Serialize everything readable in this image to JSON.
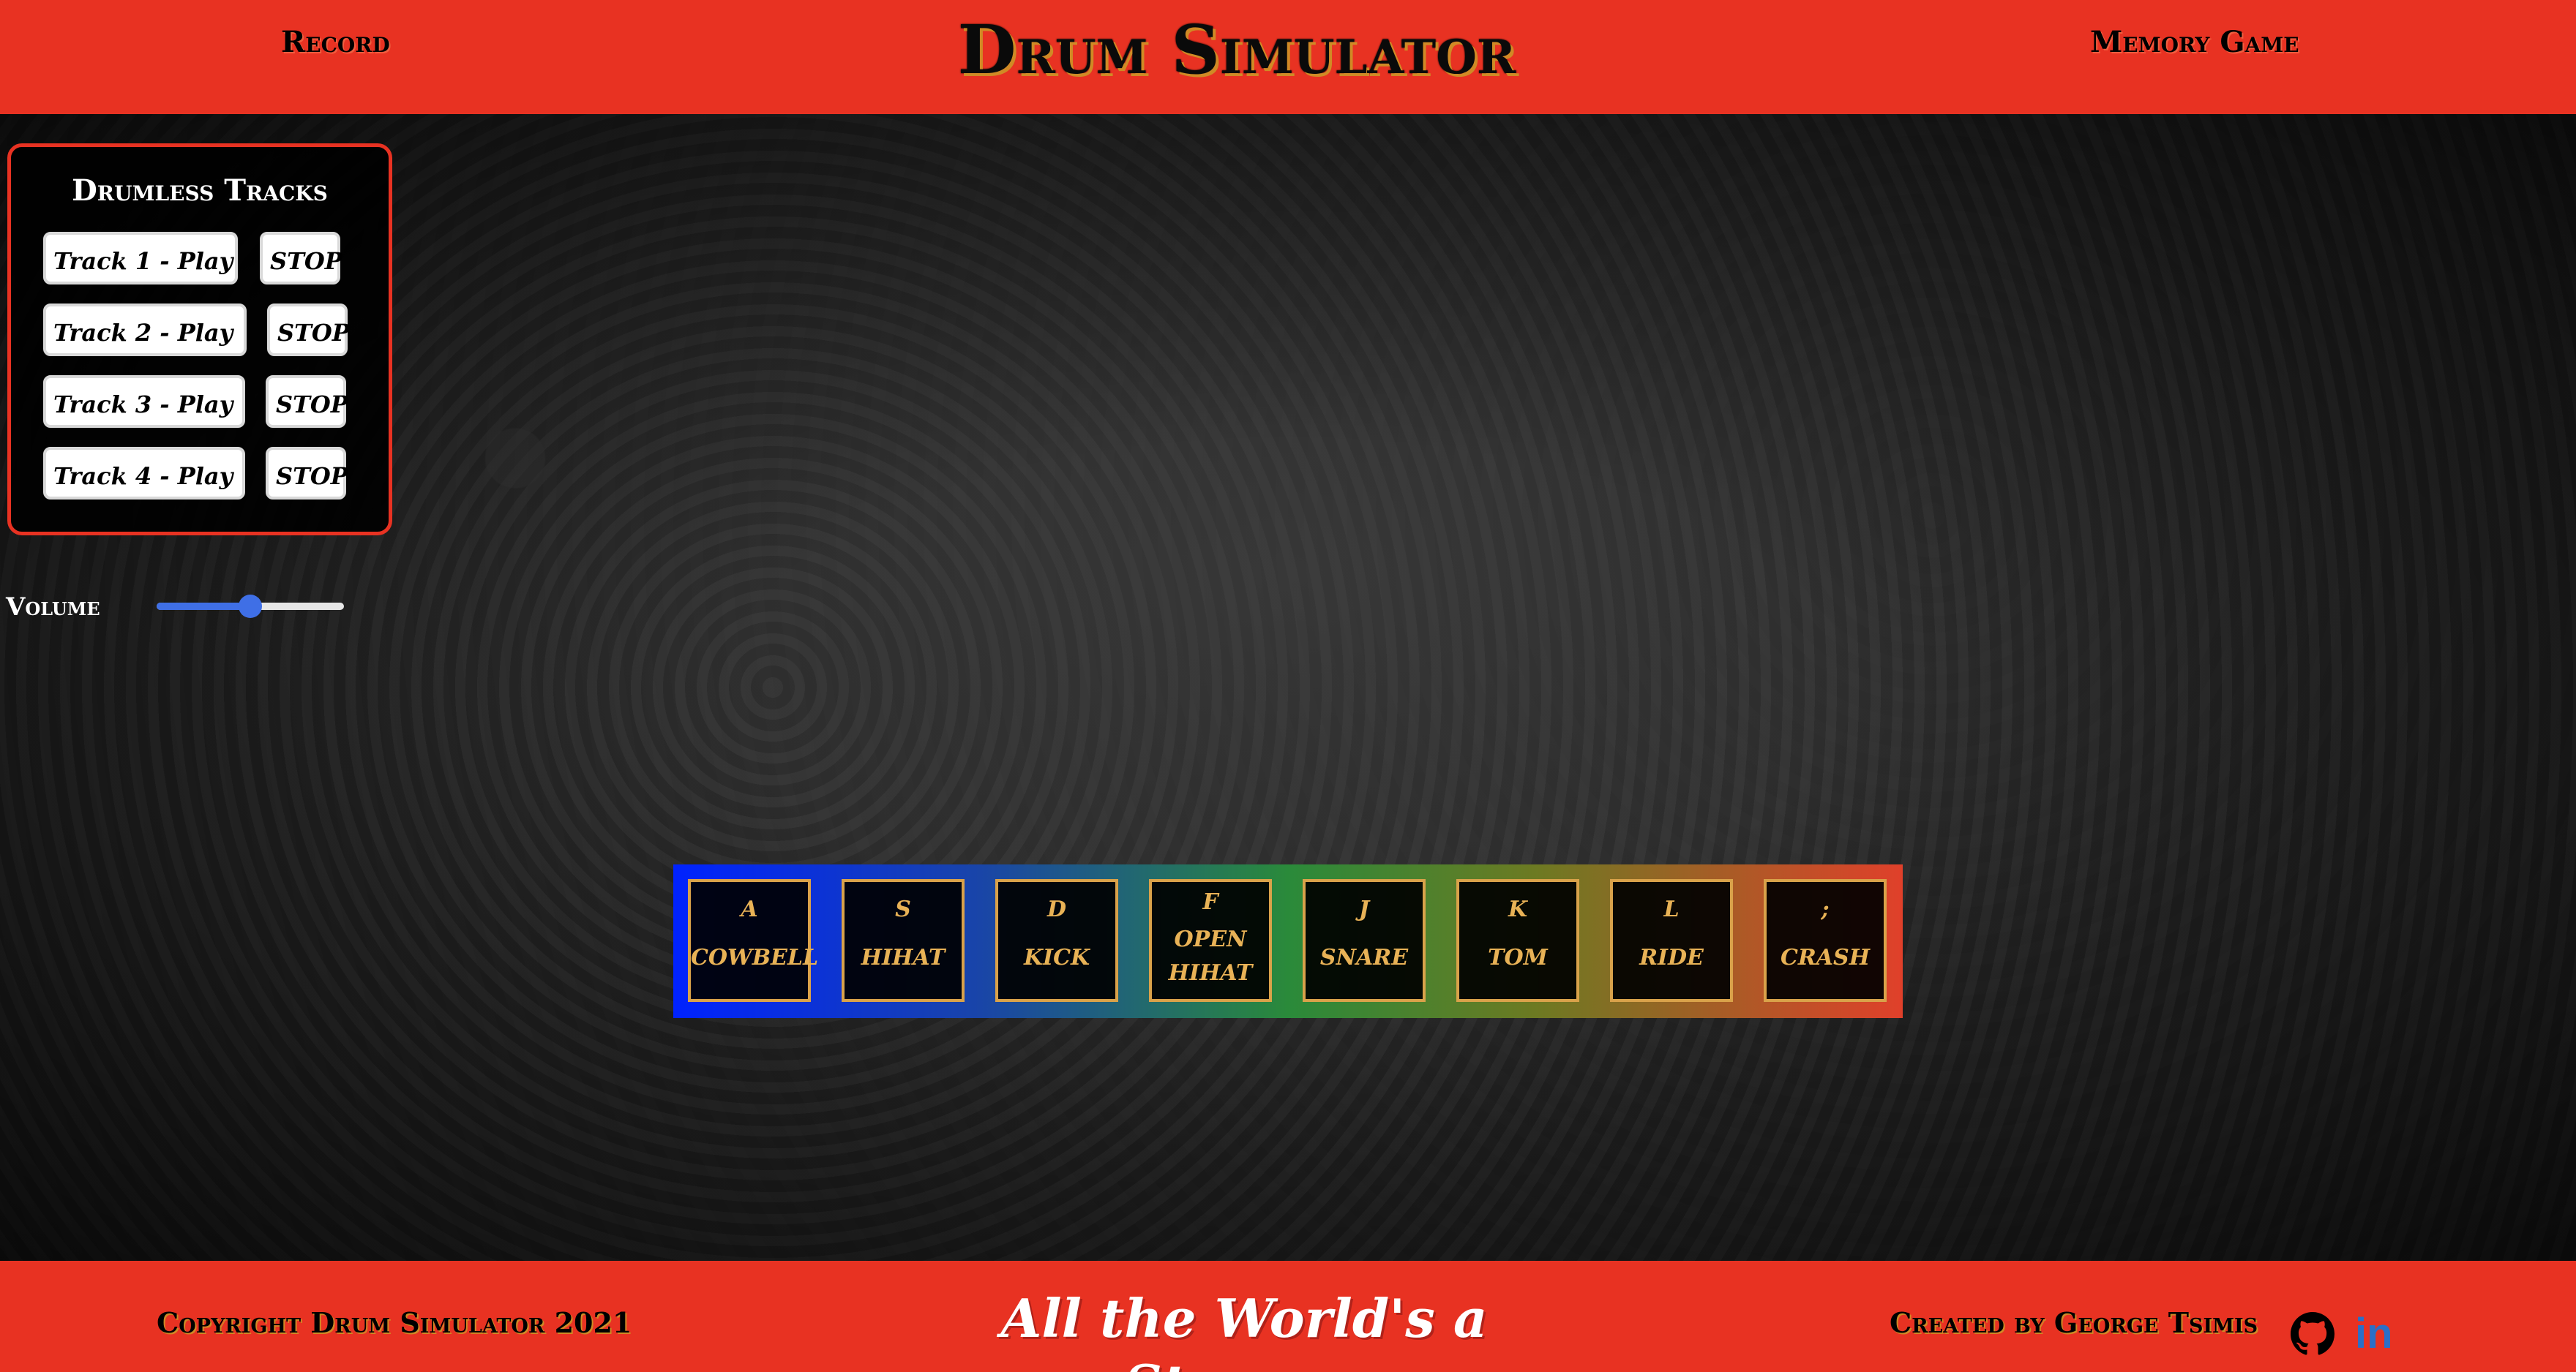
{
  "header": {
    "record_label": "Record",
    "title": "Drum Simulator",
    "memory_game_label": "Memory Game"
  },
  "tracks": {
    "title": "Drumless Tracks",
    "items": [
      {
        "play_label": "Track 1 - Play",
        "stop_label": "STOP"
      },
      {
        "play_label": "Track 2 - Play",
        "stop_label": "STOP"
      },
      {
        "play_label": "Track 3 - Play",
        "stop_label": "STOP"
      },
      {
        "play_label": "Track 4 - Play",
        "stop_label": "STOP"
      }
    ]
  },
  "volume": {
    "label": "Volume",
    "level": 0.5
  },
  "pads": [
    {
      "key": "A",
      "sound": "COWBELL"
    },
    {
      "key": "S",
      "sound": "HIHAT"
    },
    {
      "key": "D",
      "sound": "KICK"
    },
    {
      "key": "F",
      "sound": "OPEN HIHAT"
    },
    {
      "key": "J",
      "sound": "SNARE"
    },
    {
      "key": "K",
      "sound": "TOM"
    },
    {
      "key": "L",
      "sound": "RIDE"
    },
    {
      "key": ";",
      "sound": "CRASH"
    }
  ],
  "footer": {
    "copyright": "Copyright Drum Simulator 2021",
    "tagline": "All the World's a Stage ...",
    "credit": "Created by George Tsimis",
    "github_icon": "github-icon",
    "linkedin_icon": "linkedin-icon",
    "linkedin_text": "in"
  },
  "colors": {
    "accent": "#e83222",
    "pad_text": "#e8b256",
    "slider": "#3f6fe6"
  }
}
